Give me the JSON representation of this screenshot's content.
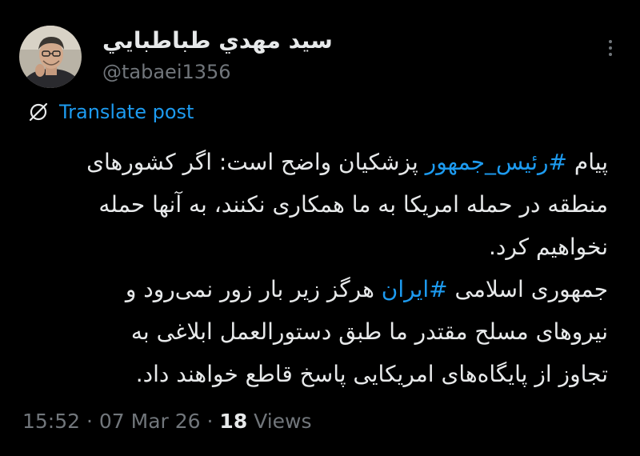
{
  "author": {
    "display_name": "سيد مهدي طباطبايي",
    "handle": "@tabaei1356"
  },
  "translate": {
    "label": "Translate post"
  },
  "tweet": {
    "line1_pre": "پیام ",
    "line1_hashtag": "#رئیس_جمهور",
    "line1_post": " پزشکیان واضح است: اگر کشورهای",
    "line2": "منطقه در حمله امریکا به ما همکاری نکنند، به آنها حمله",
    "line3": "نخواهیم کرد.",
    "line4_pre": "جمهوری اسلامی ",
    "line4_hashtag": "#ایران",
    "line4_post": " هرگز زیر بار زور نمی‌رود و",
    "line5": "نیروهای مسلح مقتدر ما طبق دستورالعمل ابلاغی به",
    "line6": "تجاوز از پایگاه‌های امریکایی پاسخ قاطع خواهند داد."
  },
  "meta": {
    "time": "15:52",
    "separator1": " · ",
    "date": "07 Mar 26",
    "separator2": " · ",
    "views_count": "18",
    "views_label": " Views"
  },
  "colors": {
    "background": "#000000",
    "text": "#e7e9ea",
    "muted": "#71767b",
    "accent": "#1d9bf0"
  },
  "icons": {
    "translate": "translate-icon",
    "more": "more-options-icon"
  }
}
